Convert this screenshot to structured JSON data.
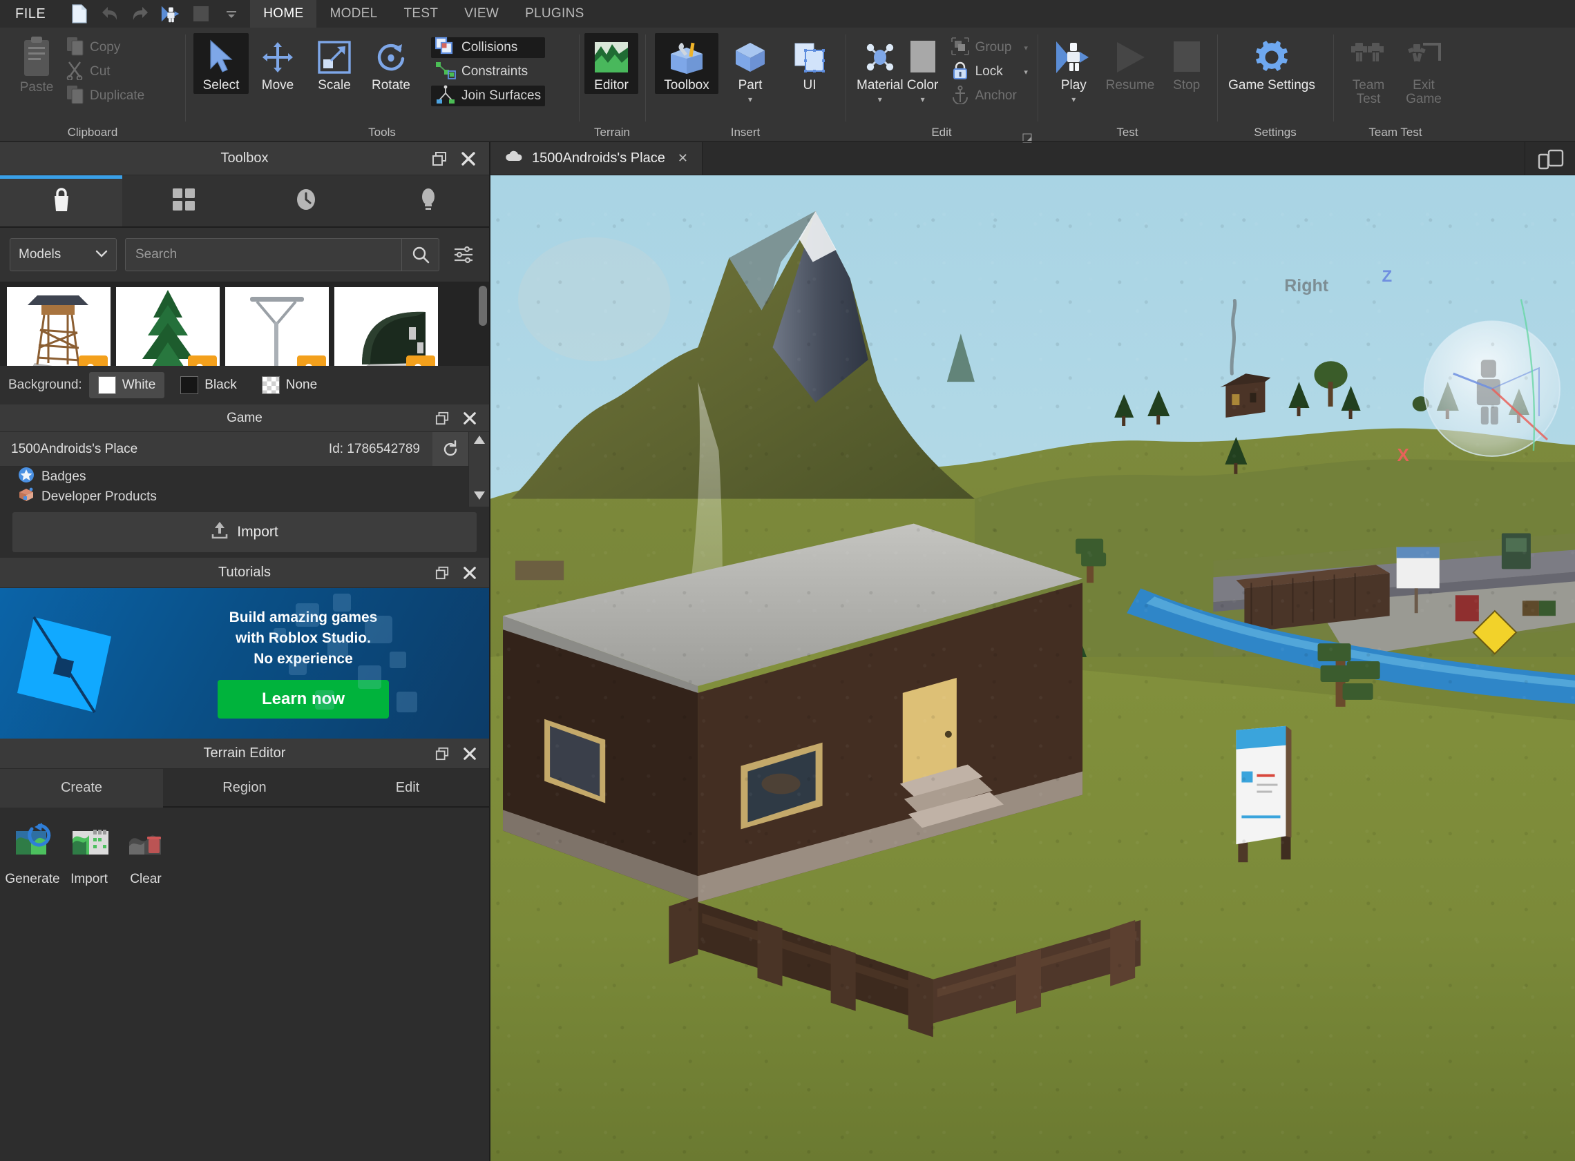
{
  "app": {
    "quick_access": {
      "file_menu": "FILE",
      "icons": [
        "new-file-icon",
        "undo-icon",
        "redo-icon",
        "play-icon",
        "stop-icon",
        "customize-caret-icon"
      ]
    },
    "ribbon_tabs": [
      {
        "label": "HOME",
        "active": true
      },
      {
        "label": "MODEL",
        "active": false
      },
      {
        "label": "TEST",
        "active": false
      },
      {
        "label": "VIEW",
        "active": false
      },
      {
        "label": "PLUGINS",
        "active": false
      }
    ]
  },
  "ribbon": {
    "groups": [
      {
        "name": "Clipboard",
        "label": "Clipboard",
        "paste": {
          "label": "Paste",
          "icon": "paste-icon",
          "enabled": false
        },
        "items": [
          {
            "label": "Copy",
            "icon": "copy-icon",
            "enabled": false
          },
          {
            "label": "Cut",
            "icon": "cut-icon",
            "enabled": false
          },
          {
            "label": "Duplicate",
            "icon": "duplicate-icon",
            "enabled": false
          }
        ]
      },
      {
        "name": "Tools",
        "label": "Tools",
        "buttons": [
          {
            "label": "Select",
            "icon": "cursor-arrow-icon",
            "selected": true
          },
          {
            "label": "Move",
            "icon": "move-arrows-icon",
            "selected": false
          },
          {
            "label": "Scale",
            "icon": "scale-icon",
            "selected": false
          },
          {
            "label": "Rotate",
            "icon": "rotate-icon",
            "selected": false
          }
        ],
        "toggles": [
          {
            "label": "Collisions",
            "icon": "collisions-icon",
            "toggled": true
          },
          {
            "label": "Constraints",
            "icon": "constraints-icon",
            "toggled": false
          },
          {
            "label": "Join Surfaces",
            "icon": "join-surfaces-icon",
            "toggled": true
          }
        ]
      },
      {
        "name": "Terrain",
        "label": "Terrain",
        "buttons": [
          {
            "label": "Editor",
            "icon": "terrain-editor-icon",
            "selected": true
          }
        ]
      },
      {
        "name": "Insert",
        "label": "Insert",
        "buttons": [
          {
            "label": "Toolbox",
            "icon": "toolbox-icon",
            "selected": true
          },
          {
            "label": "Part",
            "icon": "part-cube-icon",
            "selected": false,
            "has_caret": true
          },
          {
            "label": "UI",
            "icon": "ui-frame-icon",
            "selected": false
          }
        ]
      },
      {
        "name": "Edit",
        "label": "Edit",
        "buttons": [
          {
            "label": "Material",
            "icon": "material-icon",
            "has_caret": true
          },
          {
            "label": "Color",
            "icon": "color-swatch-icon",
            "has_caret": true
          }
        ],
        "items": [
          {
            "label": "Group",
            "icon": "group-icon",
            "enabled": false,
            "has_caret": true
          },
          {
            "label": "Lock",
            "icon": "lock-icon",
            "enabled": true,
            "has_caret": true
          },
          {
            "label": "Anchor",
            "icon": "anchor-icon",
            "enabled": false,
            "has_caret": false
          }
        ],
        "dialog_launcher": "dialog-launcher-icon"
      },
      {
        "name": "Test",
        "label": "Test",
        "buttons": [
          {
            "label": "Play",
            "icon": "play-avatar-icon",
            "enabled": true,
            "has_caret": true
          },
          {
            "label": "Resume",
            "icon": "resume-triangle-icon",
            "enabled": false
          },
          {
            "label": "Stop",
            "icon": "stop-square-icon",
            "enabled": false
          }
        ]
      },
      {
        "name": "Settings",
        "label": "Settings",
        "buttons": [
          {
            "label": "Game Settings",
            "icon": "gear-icon",
            "enabled": true
          }
        ]
      },
      {
        "name": "Team Test",
        "label": "Team Test",
        "buttons": [
          {
            "label": "Team Test",
            "icon": "team-test-icon",
            "enabled": false
          },
          {
            "label": "Exit Game",
            "icon": "exit-game-icon",
            "enabled": false
          }
        ]
      }
    ]
  },
  "toolbox": {
    "title": "Toolbox",
    "window_controls": [
      "popout-icon",
      "close-icon"
    ],
    "tabs": [
      {
        "icon": "shopping-bag-icon",
        "name": "marketplace",
        "active": true
      },
      {
        "icon": "grid-inventory-icon",
        "name": "inventory",
        "active": false
      },
      {
        "icon": "clock-recent-icon",
        "name": "recent",
        "active": false
      },
      {
        "icon": "lightbulb-creations-icon",
        "name": "creations",
        "active": false
      }
    ],
    "category": "Models",
    "search": {
      "placeholder": "Search",
      "value": ""
    },
    "filter_icon": "sliders-filter-icon",
    "results": [
      {
        "name": "watchtower-model",
        "thumb": "watchtower"
      },
      {
        "name": "pine-tree-model",
        "thumb": "pine-tree"
      },
      {
        "name": "street-lamp-model",
        "thumb": "street-lamp"
      },
      {
        "name": "quonset-hut-model",
        "thumb": "quonset-hut"
      }
    ],
    "background_label": "Background:",
    "background_options": [
      {
        "label": "White",
        "selected": true
      },
      {
        "label": "Black",
        "selected": false
      },
      {
        "label": "None",
        "selected": false
      }
    ]
  },
  "game_panel": {
    "title": "Game",
    "window_controls": [
      "popout-icon",
      "close-icon"
    ],
    "place_name": "1500Androids's Place",
    "place_id": "Id: 1786542789",
    "refresh_icon": "refresh-icon",
    "tree_items": [
      {
        "label": "Badges",
        "icon": "badge-icon"
      },
      {
        "label": "Developer Products",
        "icon": "developer-products-icon"
      }
    ],
    "import_button": "Import",
    "import_icon": "upload-icon"
  },
  "tutorials": {
    "title": "Tutorials",
    "window_controls": [
      "popout-icon",
      "close-icon"
    ],
    "logo": "roblox-logo-icon",
    "lines": [
      "Build amazing games",
      "with Roblox Studio.",
      "No experience"
    ],
    "cta": "Learn now",
    "cta_color": "#00b33c"
  },
  "terrain_editor": {
    "title": "Terrain Editor",
    "window_controls": [
      "popout-icon",
      "close-icon"
    ],
    "tabs": [
      {
        "label": "Create",
        "active": true
      },
      {
        "label": "Region",
        "active": false
      },
      {
        "label": "Edit",
        "active": false
      }
    ],
    "tools": [
      {
        "label": "Generate",
        "icon": "terrain-generate-icon"
      },
      {
        "label": "Import",
        "icon": "terrain-import-icon"
      },
      {
        "label": "Clear",
        "icon": "terrain-clear-icon"
      }
    ]
  },
  "viewport": {
    "tab": {
      "label": "1500Androids's Place",
      "icon": "cloud-icon",
      "close": "×"
    },
    "device_emulation_icon": "device-emulation-icon",
    "gizmo": {
      "x_axis_label": "X",
      "z_axis_label": "Z",
      "selection_label": "Right"
    },
    "scene": {
      "description": "3D baseplate world with terrain",
      "sky_color": "#b5dae8",
      "grass_color": "#7b8a35",
      "water_color": "#2f86c8",
      "objects": [
        "snow-capped-mountain",
        "waterfall-mist",
        "pine-trees",
        "grass-hills",
        "brick-house-foreground",
        "wooden-fence",
        "river",
        "billboard-sign",
        "walled-compound",
        "distant-cabin",
        "chimney-smoke",
        "selection-sphere"
      ]
    }
  },
  "colors": {
    "accent_blue": "#3aa0e8",
    "panel_bg": "#2d2d2d",
    "panel_header": "#3a3a3a",
    "ribbon_bg": "#353535",
    "toggled_bg": "#1b1b1b",
    "text": "#d8d8d8",
    "disabled_text": "#6e6e6e",
    "green_cta": "#00b33c",
    "axis_x": "#e8625a",
    "axis_z": "#6f8fe0"
  }
}
